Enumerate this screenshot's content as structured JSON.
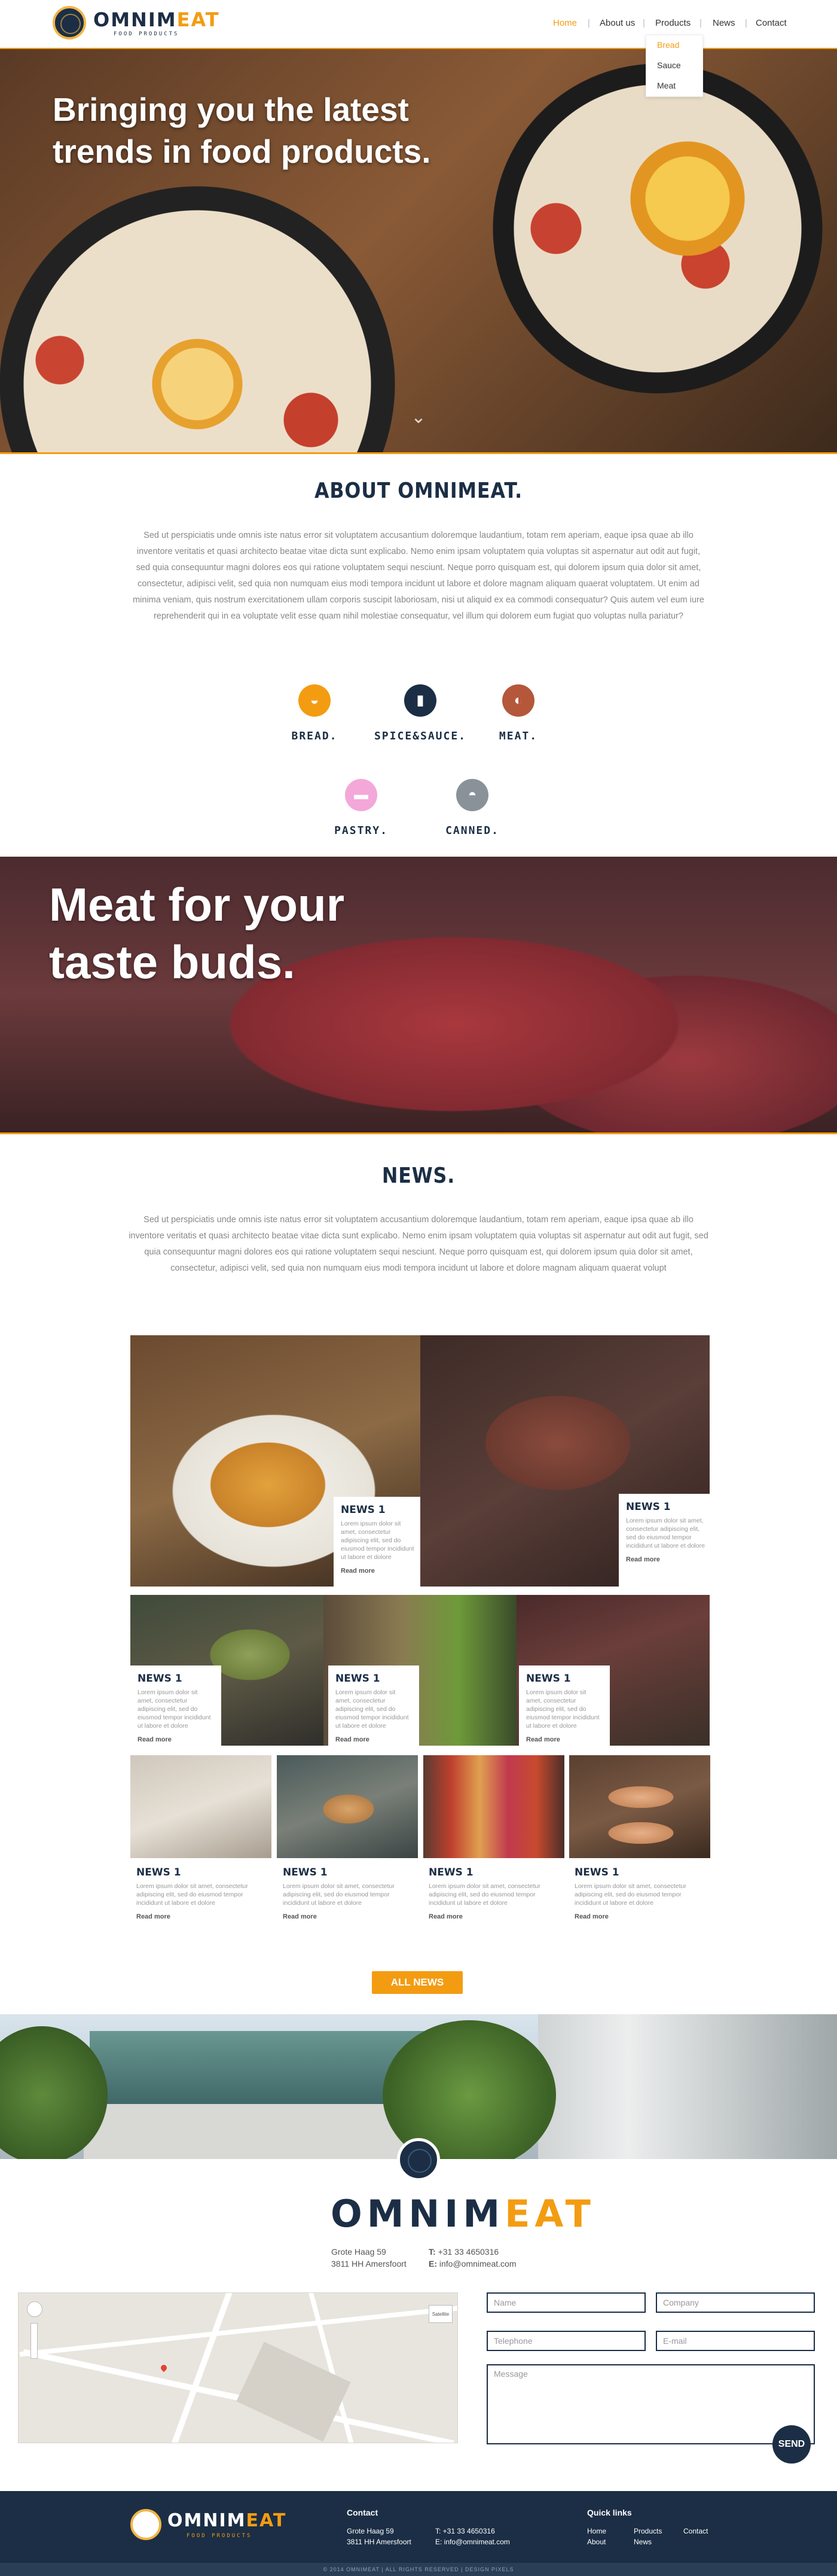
{
  "brand": {
    "part1": "OMNIM",
    "part2": "EAT",
    "tagline": "FOOD PRODUCTS"
  },
  "nav": {
    "home": "Home",
    "about": "About us",
    "products": "Products",
    "news": "News",
    "contact": "Contact",
    "sep": "|"
  },
  "dropdown": {
    "items": [
      "Bread",
      "Sauce",
      "Meat"
    ]
  },
  "hero": {
    "title": "Bringing you the latest trends in food products.",
    "arrow": "⌄"
  },
  "about": {
    "title": "ABOUT OMNIMEAT.",
    "text": "Sed ut perspiciatis unde omnis iste natus error sit voluptatem accusantium doloremque laudantium, totam rem aperiam, eaque ipsa quae ab illo inventore veritatis et quasi architecto beatae vitae dicta sunt explicabo. Nemo enim ipsam voluptatem quia voluptas sit aspernatur aut odit aut fugit, sed quia consequuntur magni dolores eos qui ratione voluptatem sequi nesciunt. Neque porro quisquam est, qui dolorem ipsum quia dolor sit amet, consectetur, adipisci velit, sed quia non numquam eius modi tempora incidunt ut labore et dolore magnam aliquam quaerat voluptatem. Ut enim ad minima veniam, quis nostrum exercitationem ullam corporis suscipit laboriosam, nisi ut aliquid ex ea commodi consequatur? Quis autem vel eum iure reprehenderit qui in ea voluptate velit esse quam nihil molestiae consequatur, vel illum qui dolorem eum fugiat quo voluptas nulla pariatur?",
    "categories": [
      {
        "label": "BREAD.",
        "color": "#f39c12",
        "icon": "bread-icon",
        "glyph": "◒"
      },
      {
        "label": "SPICE&SAUCE.",
        "color": "#1b2e45",
        "icon": "sauce-bottle-icon",
        "glyph": "▮"
      },
      {
        "label": "MEAT.",
        "color": "#b5573a",
        "icon": "steak-icon",
        "glyph": "◐"
      },
      {
        "label": "PASTRY.",
        "color": "#f4a7d9",
        "icon": "cake-icon",
        "glyph": "▬"
      },
      {
        "label": "CANNED.",
        "color": "#8a9299",
        "icon": "can-icon",
        "glyph": "◓"
      }
    ]
  },
  "banner": {
    "title": "Meat for your taste buds."
  },
  "news": {
    "title": "NEWS.",
    "text": "Sed ut perspiciatis unde omnis iste natus error sit voluptatem accusantium doloremque laudantium, totam rem aperiam, eaque ipsa quae ab illo inventore veritatis et quasi architecto beatae vitae dicta sunt explicabo. Nemo enim ipsam voluptatem quia voluptas sit aspernatur aut odit aut fugit, sed quia consequuntur magni dolores eos qui ratione voluptatem sequi nesciunt. Neque porro quisquam est, qui dolorem ipsum quia dolor sit amet, consectetur, adipisci velit, sed quia non numquam eius modi tempora incidunt ut labore et dolore magnam aliquam quaerat volupt",
    "item_title": "NEWS 1",
    "item_text": "Lorem ipsum dolor sit amet, consectetur adipiscing elit, sed do eiusmod tempor incididunt ut labore et dolore",
    "read_more": "Read more",
    "all_news": "ALL NEWS"
  },
  "contact": {
    "address1": "Grote Haag 59",
    "address2": "3811 HH Amersfoort",
    "tel_label": "T:",
    "tel": "+31 33 4650316",
    "email_label": "E:",
    "email": "info@omnimeat.com",
    "map_label": "Satellite",
    "placeholders": {
      "name": "Name",
      "company": "Company",
      "telephone": "Telephone",
      "email": "E-mail",
      "message": "Message"
    },
    "send": "SEND"
  },
  "footer": {
    "contact_title": "Contact",
    "address1": "Grote Haag 59",
    "address2": "3811 HH Amersfoort",
    "tel": "T: +31 33 4650316",
    "email": "E: info@omnimeat.com",
    "links_title": "Quick links",
    "links": [
      "Home",
      "Products",
      "Contact",
      "About",
      "News"
    ],
    "copyright": "© 2014 OMNIMEAT | ALL RIGHTS RESERVED | DESIGN PIXELS"
  },
  "colors": {
    "accent": "#f39c12",
    "navy": "#1b2e45"
  }
}
